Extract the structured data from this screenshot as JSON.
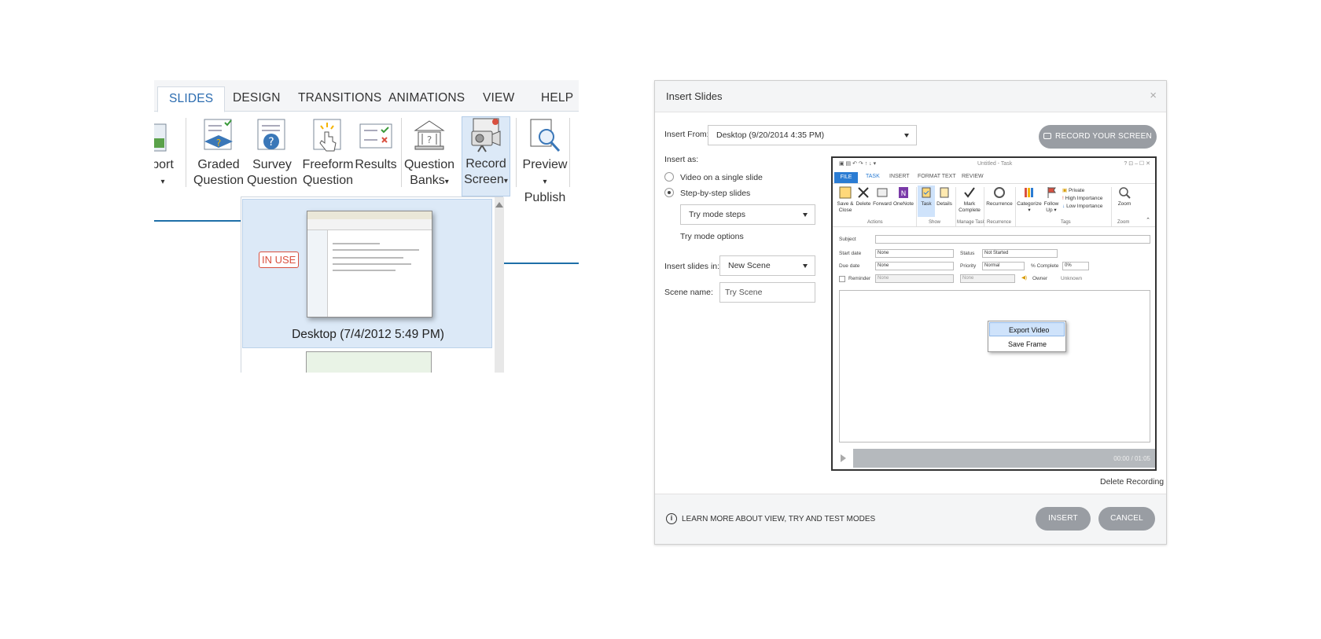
{
  "ribbon": {
    "tabs": [
      "SLIDES",
      "DESIGN",
      "TRANSITIONS",
      "ANIMATIONS",
      "VIEW",
      "HELP"
    ],
    "buttons": {
      "import_line1": "port",
      "graded_line1": "Graded",
      "graded_line2": "Question",
      "survey_line1": "Survey",
      "survey_line2": "Question",
      "freeform_line1": "Freeform",
      "freeform_line2": "Question",
      "results": "Results",
      "banks_line1": "Question",
      "banks_line2": "Banks",
      "record_line1": "Record",
      "record_line2": "Screen",
      "preview": "Preview",
      "publish": "Publish"
    },
    "dropdown": {
      "in_use": "IN USE",
      "recording_label": "Desktop (7/4/2012 5:49 PM)"
    },
    "colors": {
      "accent": "#1e6fa8",
      "selected_bg": "#dce9f7",
      "in_use": "#d9503f"
    }
  },
  "dialog": {
    "title": "Insert Slides",
    "close_glyph": "×",
    "insert_from_label": "Insert From:",
    "insert_from_value": "Desktop (9/20/2014 4:35 PM)",
    "record_button": "RECORD YOUR SCREEN",
    "insert_as_label": "Insert as:",
    "option_single": "Video on a single slide",
    "option_step": "Step-by-step slides",
    "try_mode_value": "Try mode steps",
    "try_mode_options": "Try mode options",
    "insert_in_label": "Insert slides in:",
    "insert_in_value": "New Scene",
    "scene_name_label": "Scene name:",
    "scene_name_value": "Try Scene",
    "delete_recording": "Delete Recording",
    "learn_more": "LEARN MORE ABOUT VIEW, TRY AND TEST MODES",
    "insert_button": "INSERT",
    "cancel_button": "CANCEL",
    "colors": {
      "pill": "#999da3",
      "outlook_blue": "#2b7cd3"
    }
  },
  "outlook": {
    "window_title": "Untitled - Task",
    "window_controls": "?  ⊡  –  ☐  ✕",
    "tabs": [
      "FILE",
      "TASK",
      "INSERT",
      "FORMAT TEXT",
      "REVIEW"
    ],
    "buttons": {
      "save_close_1": "Save &",
      "save_close_2": "Close",
      "delete": "Delete",
      "forward": "Forward",
      "onenote": "OneNote",
      "task": "Task",
      "details": "Details",
      "mark_1": "Mark",
      "mark_2": "Complete",
      "recurrence": "Recurrence",
      "categorize_1": "Categorize",
      "categorize_2": "▾",
      "follow_1": "Follow",
      "follow_2": "Up ▾",
      "private": "Private",
      "high": "High Importance",
      "low": "Low Importance",
      "zoom": "Zoom"
    },
    "groups": [
      "Actions",
      "Show",
      "Manage Task",
      "Recurrence",
      "Tags",
      "Zoom"
    ],
    "fields": {
      "subject_label": "Subject",
      "start_label": "Start date",
      "start_value": "None",
      "due_label": "Due date",
      "due_value": "None",
      "reminder_label": "Reminder",
      "reminder_value": "None",
      "reminder_time": "None",
      "status_label": "Status",
      "status_value": "Not Started",
      "priority_label": "Priority",
      "priority_value": "Normal",
      "complete_label": "% Complete",
      "complete_value": "0%",
      "owner_label": "Owner",
      "owner_value": "Unknown"
    },
    "context_menu": [
      "Export Video",
      "Save Frame"
    ],
    "player_time": "00:00 / 01:05"
  }
}
